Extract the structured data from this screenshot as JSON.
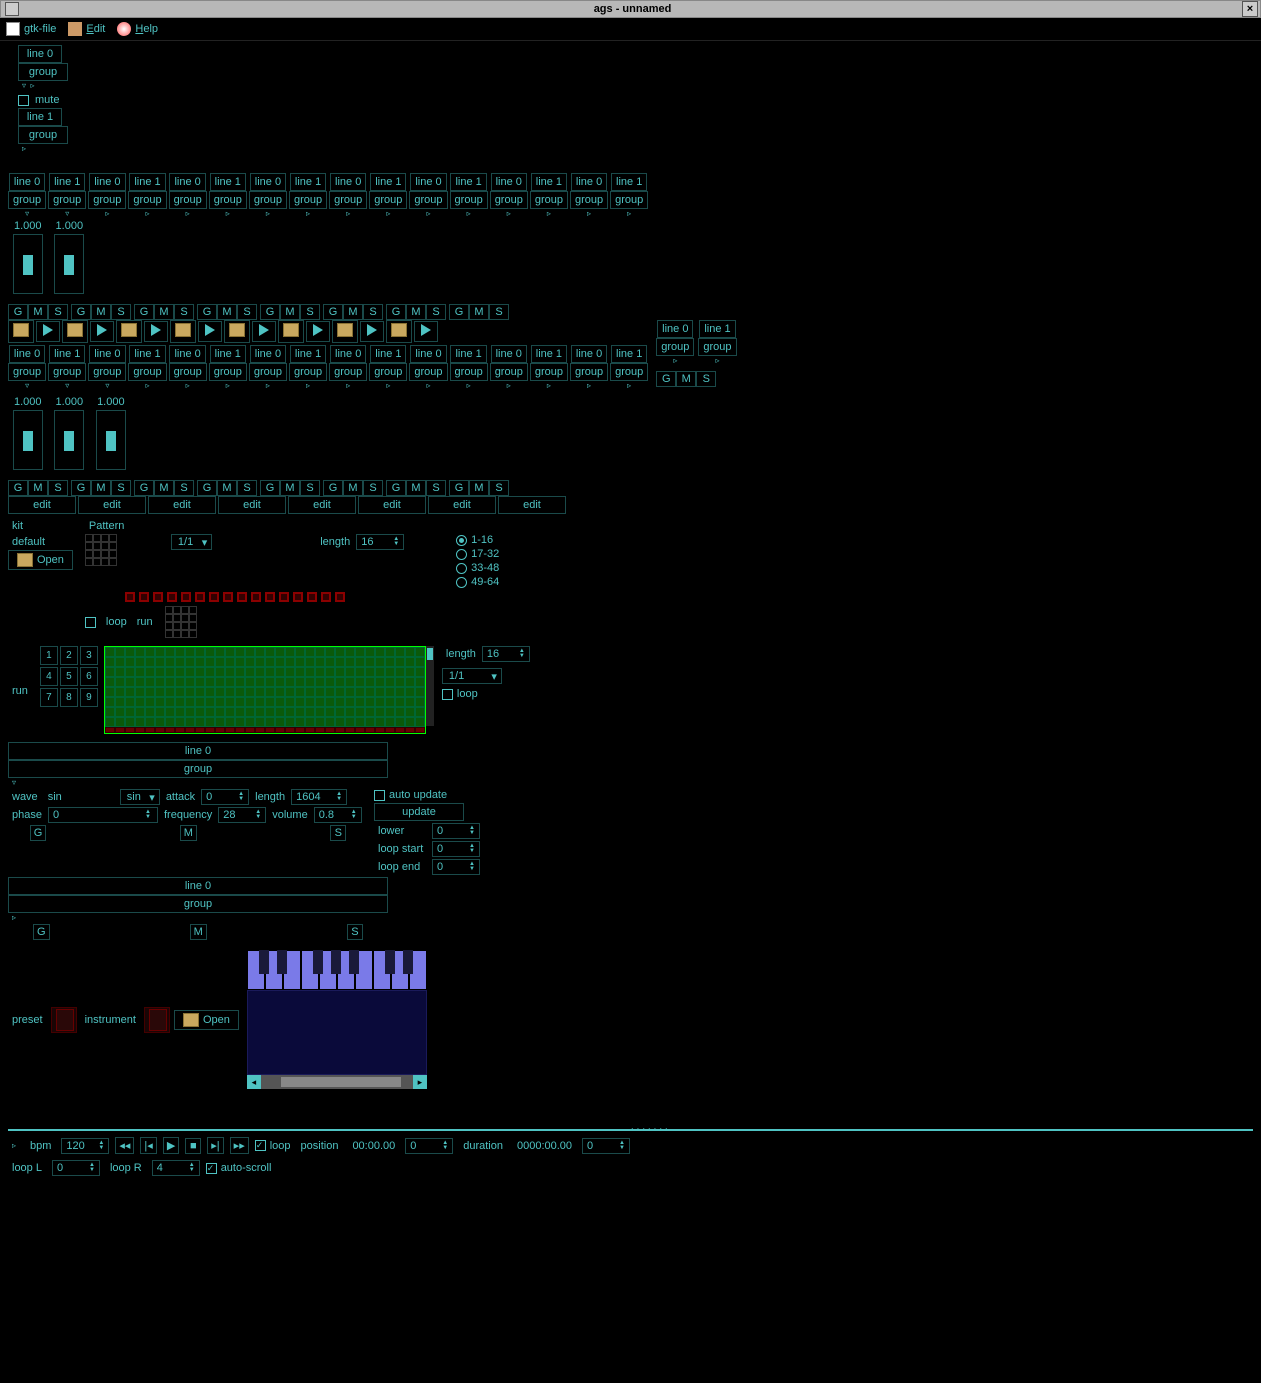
{
  "window": {
    "title": "ags - unnamed"
  },
  "menu": {
    "file": "gtk-file",
    "edit": "Edit",
    "help": "Help"
  },
  "labels": {
    "line0": "line 0",
    "line1": "line 1",
    "group": "group",
    "mute": "mute",
    "G": "G",
    "M": "M",
    "S": "S",
    "edit": "edit",
    "kit": "kit",
    "default": "default",
    "open": "Open",
    "pattern": "Pattern",
    "length": "length",
    "loop": "loop",
    "run": "run",
    "auto_update": "auto update",
    "update": "update",
    "wave": "wave",
    "sin": "sin",
    "attack": "attack",
    "phase": "phase",
    "frequency": "frequency",
    "volume": "volume",
    "lower": "lower",
    "loop_start": "loop start",
    "loop_end": "loop end",
    "preset": "preset",
    "instrument": "instrument",
    "bpm": "bpm",
    "position": "position",
    "duration": "duration",
    "loopL": "loop L",
    "loopR": "loop R",
    "auto_scroll": "auto-scroll",
    "val1000": "1.000"
  },
  "values": {
    "pattern_frac": "1/1",
    "pattern_len": "16",
    "green_len": "16",
    "green_frac": "1/1",
    "attack": "0",
    "phase": "0",
    "frequency": "28",
    "osc_len": "1604",
    "volume": "0.8",
    "lower": "0",
    "loop_start": "0",
    "loop_end": "0",
    "bpm": "120",
    "position_time": "00:00.00",
    "position_pct": "0",
    "duration_time": "0000:00.00",
    "duration_pct": "0",
    "loopL": "0",
    "loopR": "4"
  },
  "ranges": {
    "r1": "1-16",
    "r2": "17-32",
    "r3": "33-48",
    "r4": "49-64"
  },
  "numpad": [
    "1",
    "2",
    "3",
    "4",
    "5",
    "6",
    "7",
    "8",
    "9"
  ]
}
